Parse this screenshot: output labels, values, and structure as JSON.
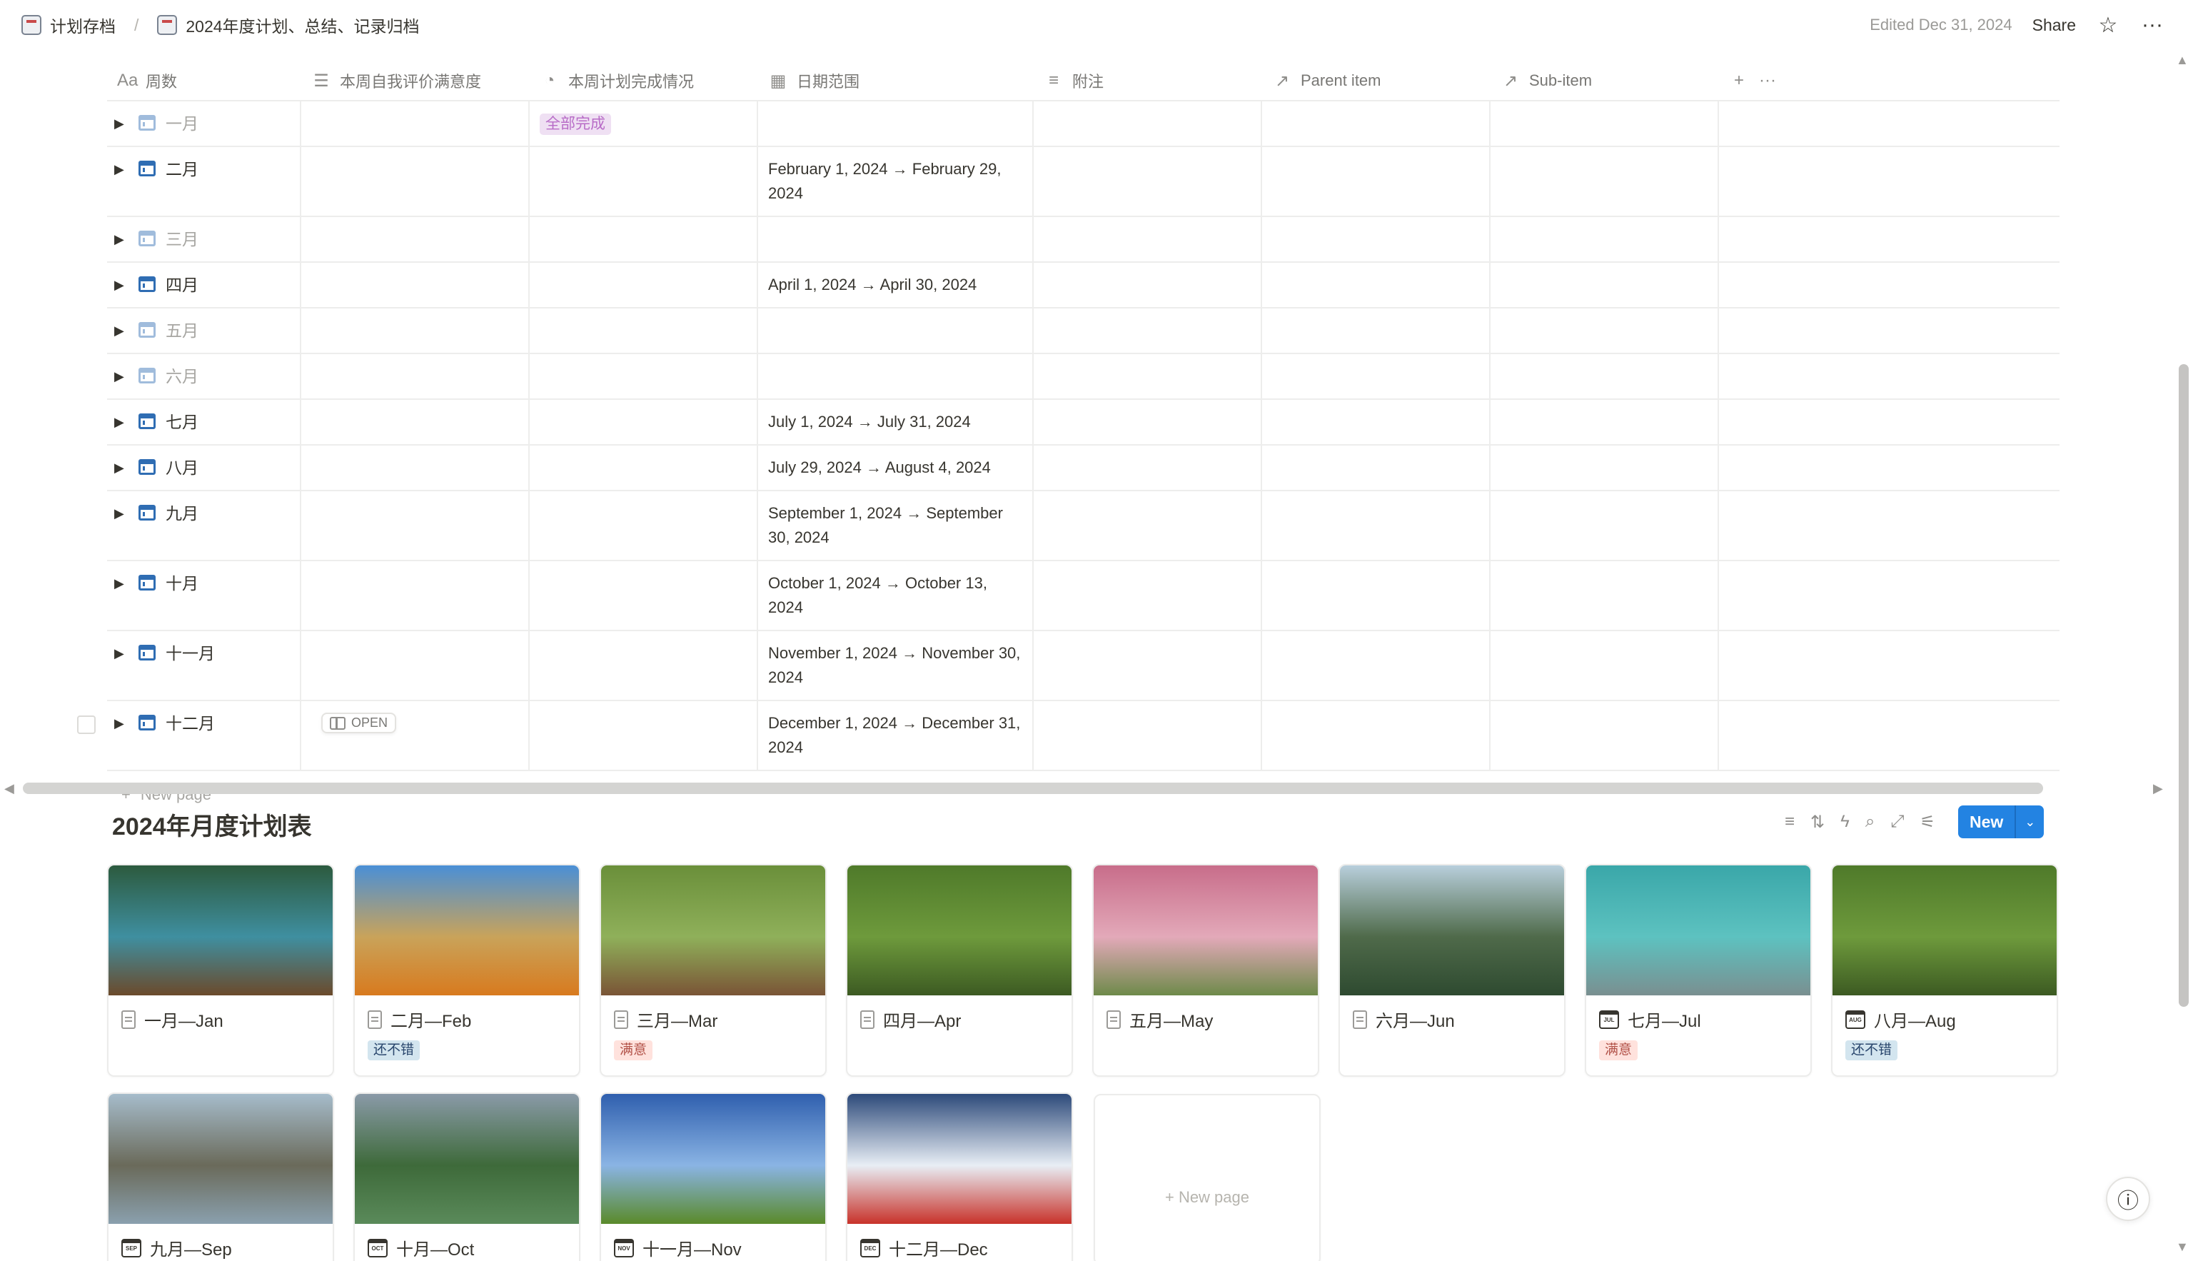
{
  "breadcrumb": {
    "items": [
      "计划存档",
      "2024年度计划、总结、记录归档"
    ],
    "separator": "/"
  },
  "topbar": {
    "edited": "Edited Dec 31, 2024",
    "share": "Share",
    "favorite_icon": "star-icon",
    "more_icon": "more-horizontal-icon"
  },
  "table": {
    "columns": [
      {
        "label": "周数",
        "icon": "text-aa-icon"
      },
      {
        "label": "本周自我评价满意度",
        "icon": "list-icon"
      },
      {
        "label": "本周计划完成情况",
        "icon": "status-icon"
      },
      {
        "label": "日期范围",
        "icon": "calendar-icon"
      },
      {
        "label": "附注",
        "icon": "lines-icon"
      },
      {
        "label": "Parent item",
        "icon": "relation-arrow-icon"
      },
      {
        "label": "Sub-item",
        "icon": "relation-arrow-icon"
      }
    ],
    "add_icon": "+",
    "more_icon": "···",
    "rows": [
      {
        "name": "一月",
        "faded": true,
        "status": "全部完成",
        "date": ""
      },
      {
        "name": "二月",
        "faded": false,
        "status": "",
        "date": "February 1, 2024 → February 29, 2024"
      },
      {
        "name": "三月",
        "faded": true,
        "status": "",
        "date": ""
      },
      {
        "name": "四月",
        "faded": false,
        "status": "",
        "date": "April 1, 2024 → April 30, 2024"
      },
      {
        "name": "五月",
        "faded": true,
        "status": "",
        "date": ""
      },
      {
        "name": "六月",
        "faded": true,
        "status": "",
        "date": ""
      },
      {
        "name": "七月",
        "faded": false,
        "status": "",
        "date": "July 1, 2024 → July 31, 2024"
      },
      {
        "name": "八月",
        "faded": false,
        "status": "",
        "date": "July 29, 2024 → August 4, 2024"
      },
      {
        "name": "九月",
        "faded": false,
        "status": "",
        "date": "September 1, 2024 → September 30, 2024"
      },
      {
        "name": "十月",
        "faded": false,
        "status": "",
        "date": "October 1, 2024 → October 13, 2024"
      },
      {
        "name": "十一月",
        "faded": false,
        "status": "",
        "date": "November 1, 2024 → November 30, 2024"
      },
      {
        "name": "十二月",
        "faded": false,
        "status": "",
        "date": "December 1, 2024 → December 31, 2024",
        "open_badge": "OPEN"
      }
    ],
    "new_page": "New page"
  },
  "gallery": {
    "title": "2024年月度计划表",
    "new_button": "New",
    "tools": [
      "filter-icon",
      "sort-icon",
      "lightning-icon",
      "search-icon",
      "expand-icon",
      "settings-icon"
    ],
    "cards": [
      {
        "title": "一月—Jan",
        "icon": "doc",
        "tag": "",
        "tag_color": "",
        "img": [
          "#2c5a3e",
          "#3f8fa0",
          "#6b4a2b"
        ]
      },
      {
        "title": "二月—Feb",
        "icon": "doc",
        "tag": "还不错",
        "tag_color": "blue",
        "img": [
          "#4a8fd6",
          "#c9a35a",
          "#d87a1e"
        ]
      },
      {
        "title": "三月—Mar",
        "icon": "doc",
        "tag": "满意",
        "tag_color": "red",
        "img": [
          "#6a8f3a",
          "#8fb05a",
          "#7a5436"
        ]
      },
      {
        "title": "四月—Apr",
        "icon": "doc",
        "tag": "",
        "tag_color": "",
        "img": [
          "#4f7a2a",
          "#6e9a3c",
          "#3c5a22"
        ]
      },
      {
        "title": "五月—May",
        "icon": "doc",
        "tag": "",
        "tag_color": "",
        "img": [
          "#c86d8a",
          "#e3a9b9",
          "#6e8a4a"
        ]
      },
      {
        "title": "六月—Jun",
        "icon": "doc",
        "tag": "",
        "tag_color": "",
        "img": [
          "#b8cfdc",
          "#4f6a4a",
          "#2e4a30"
        ]
      },
      {
        "title": "七月—Jul",
        "icon": "cal",
        "cal_text": "JUL",
        "tag": "满意",
        "tag_color": "red",
        "img": [
          "#3aa7a9",
          "#5dc2c0",
          "#7a8f90"
        ]
      },
      {
        "title": "八月—Aug",
        "icon": "cal",
        "cal_text": "AUG",
        "tag": "还不错",
        "tag_color": "blue",
        "img": [
          "#4f7a2a",
          "#6e9a3c",
          "#3c5a22"
        ]
      },
      {
        "title": "九月—Sep",
        "icon": "cal",
        "cal_text": "SEP",
        "tag": "",
        "tag_color": "",
        "img": [
          "#a6bccb",
          "#6a6a5a",
          "#8aa0ae"
        ]
      },
      {
        "title": "十月—Oct",
        "icon": "cal",
        "cal_text": "OCT",
        "tag": "",
        "tag_color": "",
        "img": [
          "#8a9aa8",
          "#3e6a3a",
          "#5a8a5a"
        ]
      },
      {
        "title": "十一月—Nov",
        "icon": "cal",
        "cal_text": "NOV",
        "tag": "",
        "tag_color": "",
        "img": [
          "#2f5fae",
          "#8ab4e4",
          "#5a8a2a"
        ]
      },
      {
        "title": "十二月—Dec",
        "icon": "cal",
        "cal_text": "DEC",
        "tag": "",
        "tag_color": "",
        "img": [
          "#2d4a7a",
          "#e8eef5",
          "#c8322a"
        ]
      }
    ],
    "new_page": "New page"
  }
}
